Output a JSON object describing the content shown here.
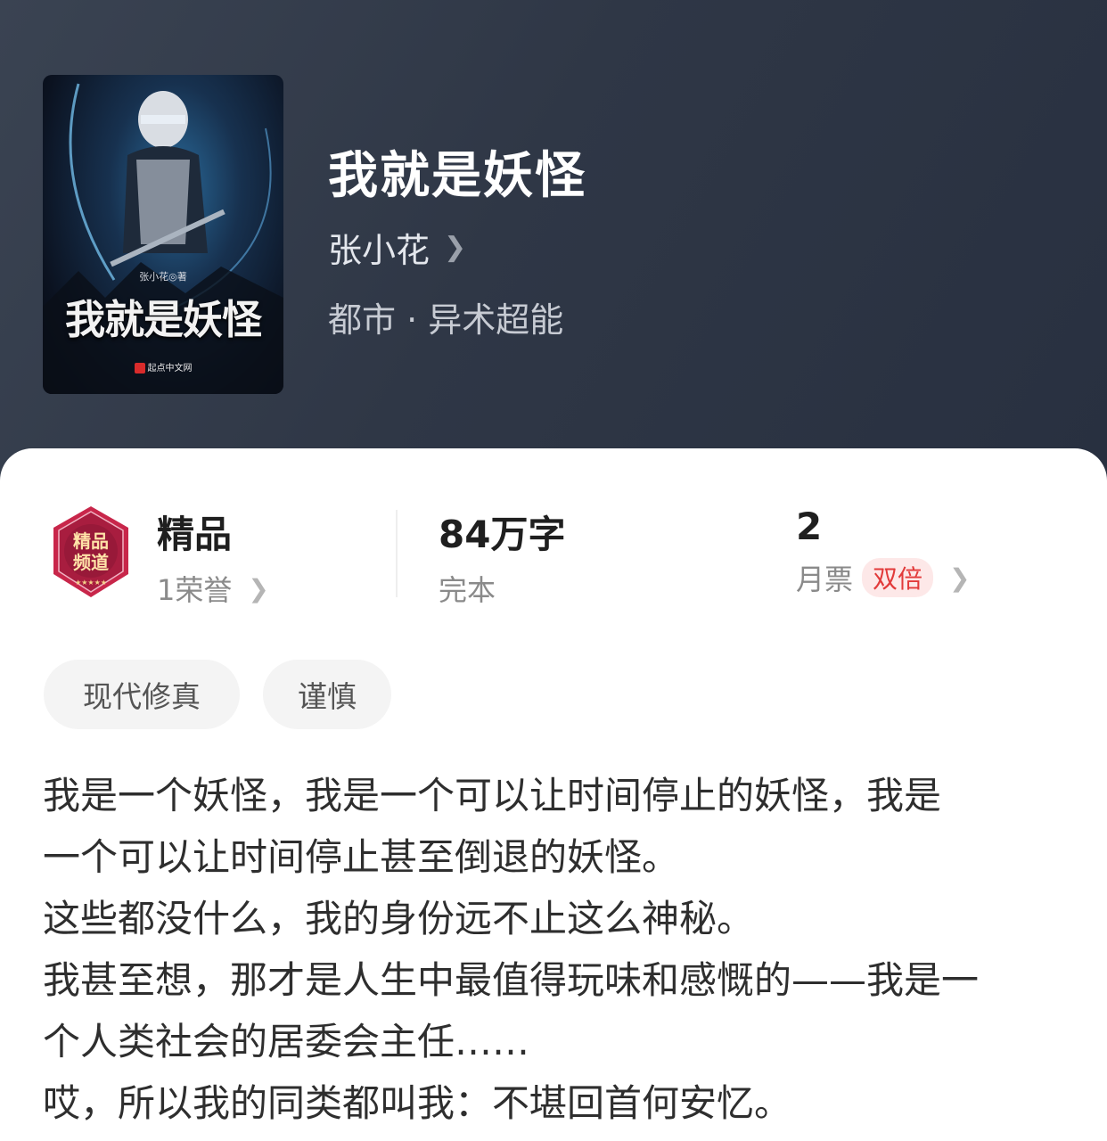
{
  "book": {
    "title": "我就是妖怪",
    "author": "张小花",
    "category": "都市 · 异术超能",
    "cover": {
      "title": "我就是妖怪",
      "author_credit": "张小花◎著",
      "publisher": "起点中文网"
    }
  },
  "stats": {
    "badge": {
      "title": "精品",
      "sub": "1荣誉",
      "image_text": "精品频道"
    },
    "words": {
      "value": "84万字",
      "sub": "完本"
    },
    "tickets": {
      "value": "2",
      "sub": "月票",
      "pill": "双倍"
    }
  },
  "tags": [
    "现代修真",
    "谨慎"
  ],
  "description": [
    "我是一个妖怪，我是一个可以让时间停止的妖怪，我是",
    "一个可以让时间停止甚至倒退的妖怪。",
    "这些都没什么，我的身份远不止这么神秘。",
    "我甚至想，那才是人生中最值得玩味和感慨的——我是一",
    "个人类社会的居委会主任……",
    "哎，所以我的同类都叫我：不堪回首何安忆。"
  ],
  "icons": {
    "author_arrow": "chevron-right-icon",
    "stat_arrow": "chevron-right-icon"
  },
  "colors": {
    "header_bg": "#2f3746",
    "accent_red": "#e23a3a",
    "badge_red": "#c8264a"
  }
}
